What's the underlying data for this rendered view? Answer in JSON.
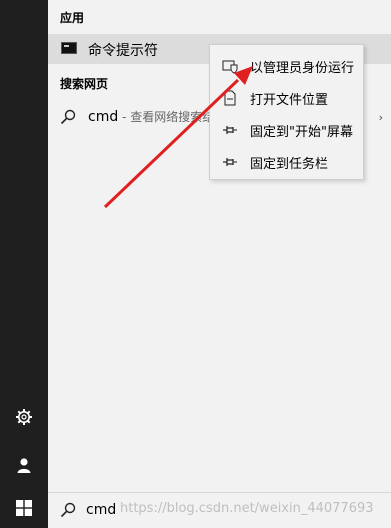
{
  "sections": {
    "best_match": "应用",
    "web": "搜索网页"
  },
  "best_match_item": {
    "label": "命令提示符",
    "icon": "cmd-terminal-icon"
  },
  "web_item": {
    "term": "cmd",
    "separator": " - ",
    "description": "查看网络搜索结果",
    "icon": "search-icon"
  },
  "context_menu": [
    {
      "label": "以管理员身份运行",
      "icon": "shield-admin-icon"
    },
    {
      "label": "打开文件位置",
      "icon": "open-file-location-icon"
    },
    {
      "label": "固定到\"开始\"屏幕",
      "icon": "pin-icon"
    },
    {
      "label": "固定到任务栏",
      "icon": "pin-icon"
    }
  ],
  "search_box": {
    "value": "cmd"
  },
  "watermark": "https://blog.csdn.net/weixin_44077693",
  "colors": {
    "rail": "#1f1f1f",
    "panel": "#f2f2f2",
    "selected_row": "#dcdcdc",
    "annotation_arrow": "#e02020"
  }
}
